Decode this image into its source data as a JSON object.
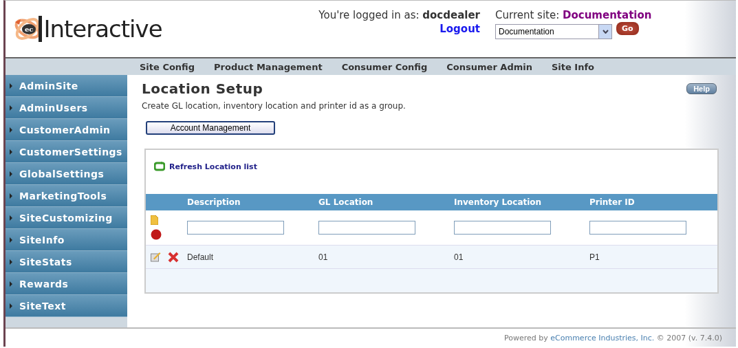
{
  "logo": {
    "badge": "ec",
    "text": "Interactive"
  },
  "user": {
    "label": "You're logged in as:",
    "name": "docdealer",
    "logout": "Logout"
  },
  "site": {
    "label": "Current site:",
    "name": "Documentation",
    "select_value": "Documentation",
    "go": "Go"
  },
  "nav": [
    "Site Config",
    "Product Management",
    "Consumer Config",
    "Consumer Admin",
    "Site Info"
  ],
  "sidebar": [
    "AdminSite",
    "AdminUsers",
    "CustomerAdmin",
    "CustomerSettings",
    "GlobalSettings",
    "MarketingTools",
    "SiteCustomizing",
    "SiteInfo",
    "SiteStats",
    "Rewards",
    "SiteText"
  ],
  "page": {
    "title": "Location Setup",
    "help": "Help",
    "description": "Create GL location, inventory location and printer id as a group.",
    "account_button": "Account Management"
  },
  "table": {
    "refresh": "Refresh Location list",
    "columns": [
      "Description",
      "GL Location",
      "Inventory Location",
      "Printer ID"
    ],
    "rows": [
      {
        "cells": [
          "Default",
          "01",
          "01",
          "P1"
        ]
      }
    ]
  },
  "footer": {
    "prefix": "Powered by",
    "link": "eCommerce Industries, Inc.",
    "suffix": "© 2007 (v. 7.4.0)"
  }
}
